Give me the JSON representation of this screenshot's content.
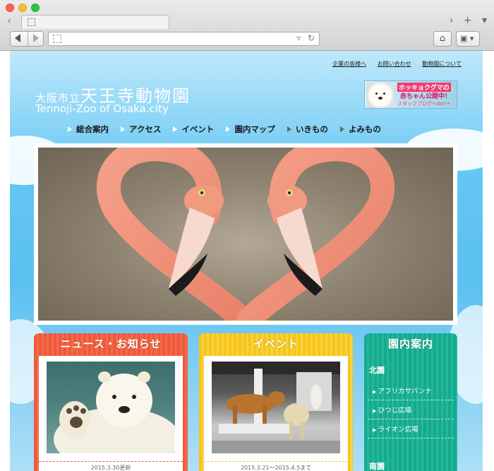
{
  "browser": {
    "tab_title": "",
    "url": ""
  },
  "header": {
    "top_links": [
      "企業の皆様へ",
      "お問い合わせ",
      "動物園について"
    ],
    "logo_jp_small": "大阪市立",
    "logo_jp_big": "天王寺動物園",
    "logo_en": "Tennoji-Zoo of Osaka.city"
  },
  "banner": {
    "line1": "ホッキョクグマの",
    "line2": "赤ちゃん公開中！",
    "line3": "スタッフブログへGo!→"
  },
  "global_nav": [
    "総合案内",
    "アクセス",
    "イベント",
    "園内マップ",
    "いきもの",
    "よみもの"
  ],
  "panels": {
    "news": {
      "title": "ニュース・お知らせ",
      "caption": "2015.3.30更新"
    },
    "event": {
      "title": "イベント",
      "caption": "2015.3.21〜2015.4.5まで"
    },
    "guide": {
      "title": "園内案内",
      "area_north": "北園",
      "items": [
        "アフリカサバンナ",
        "ひつじ広場",
        "ライオン広場"
      ],
      "area_south": "南園"
    }
  },
  "colors": {
    "sky": "#5bc0f0",
    "news": "#ef5a3a",
    "event": "#f7c518",
    "guide": "#17a98d"
  }
}
